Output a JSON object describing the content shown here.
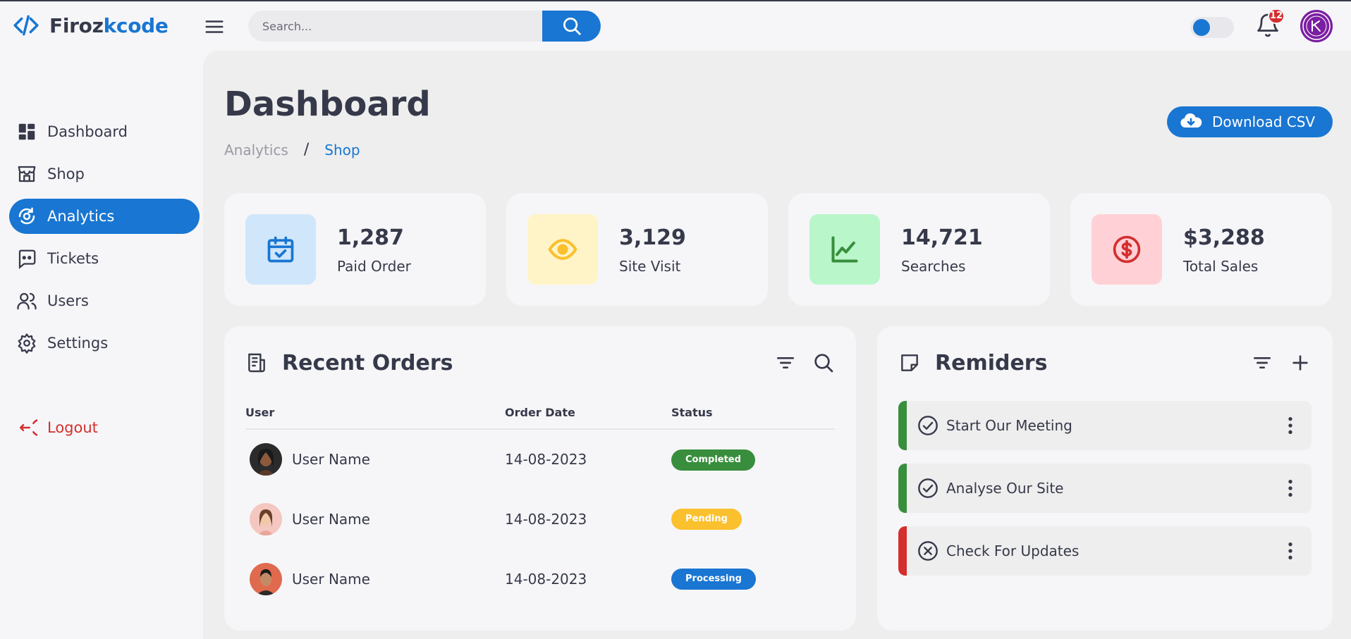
{
  "colors": {
    "primary": "#1976D2",
    "danger": "#D32F2F",
    "success": "#388E3C",
    "warning": "#FBC02D",
    "dark": "#363949"
  },
  "brand": {
    "part1": "Firoz",
    "part2": "kcode"
  },
  "search": {
    "placeholder": "Search..."
  },
  "notifications": {
    "count": "12"
  },
  "sidebar": {
    "items": [
      {
        "label": "Dashboard",
        "icon": "dashboard-icon"
      },
      {
        "label": "Shop",
        "icon": "shop-icon"
      },
      {
        "label": "Analytics",
        "icon": "analytics-icon",
        "active": true
      },
      {
        "label": "Tickets",
        "icon": "ticket-icon"
      },
      {
        "label": "Users",
        "icon": "users-icon"
      },
      {
        "label": "Settings",
        "icon": "settings-icon"
      }
    ],
    "logout": {
      "label": "Logout",
      "icon": "logout-icon"
    }
  },
  "header": {
    "title": "Dashboard",
    "breadcrumb": [
      "Analytics",
      "/",
      "Shop"
    ],
    "download_label": "Download CSV"
  },
  "insights": [
    {
      "value": "1,287",
      "label": "Paid Order",
      "icon": "calendar-check-icon",
      "bg": "#d0e6fb",
      "fg": "#1976D2"
    },
    {
      "value": "3,129",
      "label": "Site Visit",
      "icon": "eye-icon",
      "bg": "#fff4c7",
      "fg": "#FBC02D"
    },
    {
      "value": "14,721",
      "label": "Searches",
      "icon": "trending-chart-icon",
      "bg": "#b9f6ca",
      "fg": "#388E3C"
    },
    {
      "value": "$3,288",
      "label": "Total Sales",
      "icon": "dollar-icon",
      "bg": "#ffd1d6",
      "fg": "#D32F2F"
    }
  ],
  "orders": {
    "title": "Recent Orders",
    "columns": [
      "User",
      "Order Date",
      "Status"
    ],
    "rows": [
      {
        "user": "User Name",
        "date": "14-08-2023",
        "status": "Completed",
        "color": "#388E3C"
      },
      {
        "user": "User Name",
        "date": "14-08-2023",
        "status": "Pending",
        "color": "#FBC02D"
      },
      {
        "user": "User Name",
        "date": "14-08-2023",
        "status": "Processing",
        "color": "#1976D2"
      }
    ]
  },
  "reminders": {
    "title": "Remiders",
    "items": [
      {
        "text": "Start Our Meeting",
        "state": "done",
        "color": "#388E3C"
      },
      {
        "text": "Analyse Our Site",
        "state": "done",
        "color": "#388E3C"
      },
      {
        "text": "Check For Updates",
        "state": "cancelled",
        "color": "#D32F2F"
      }
    ]
  }
}
